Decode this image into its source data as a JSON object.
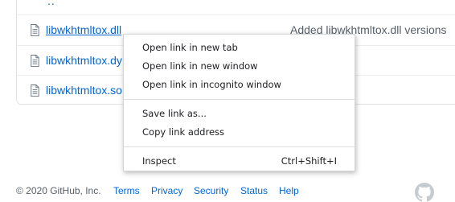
{
  "file_list": {
    "parent_link": "..",
    "files": [
      {
        "name": "libwkhtmltox.dll",
        "message": "Added libwkhtmltox.dll versions"
      },
      {
        "name": "libwkhtmltox.dy",
        "message": ""
      },
      {
        "name": "libwkhtmltox.so",
        "message": ""
      }
    ]
  },
  "context_menu": {
    "items": [
      {
        "label": "Open link in new tab",
        "shortcut": ""
      },
      {
        "label": "Open link in new window",
        "shortcut": ""
      },
      {
        "label": "Open link in incognito window",
        "shortcut": ""
      },
      {
        "label": "Save link as...",
        "shortcut": ""
      },
      {
        "label": "Copy link address",
        "shortcut": ""
      },
      {
        "label": "Inspect",
        "shortcut": "Ctrl+Shift+I"
      }
    ]
  },
  "footer": {
    "copyright": "© 2020 GitHub, Inc.",
    "links": [
      "Terms",
      "Privacy",
      "Security",
      "Status",
      "Help"
    ],
    "logo_icon": "github-mark-icon"
  },
  "colors": {
    "link": "#0366d6",
    "muted": "#586069",
    "border": "#e1e4e8"
  }
}
